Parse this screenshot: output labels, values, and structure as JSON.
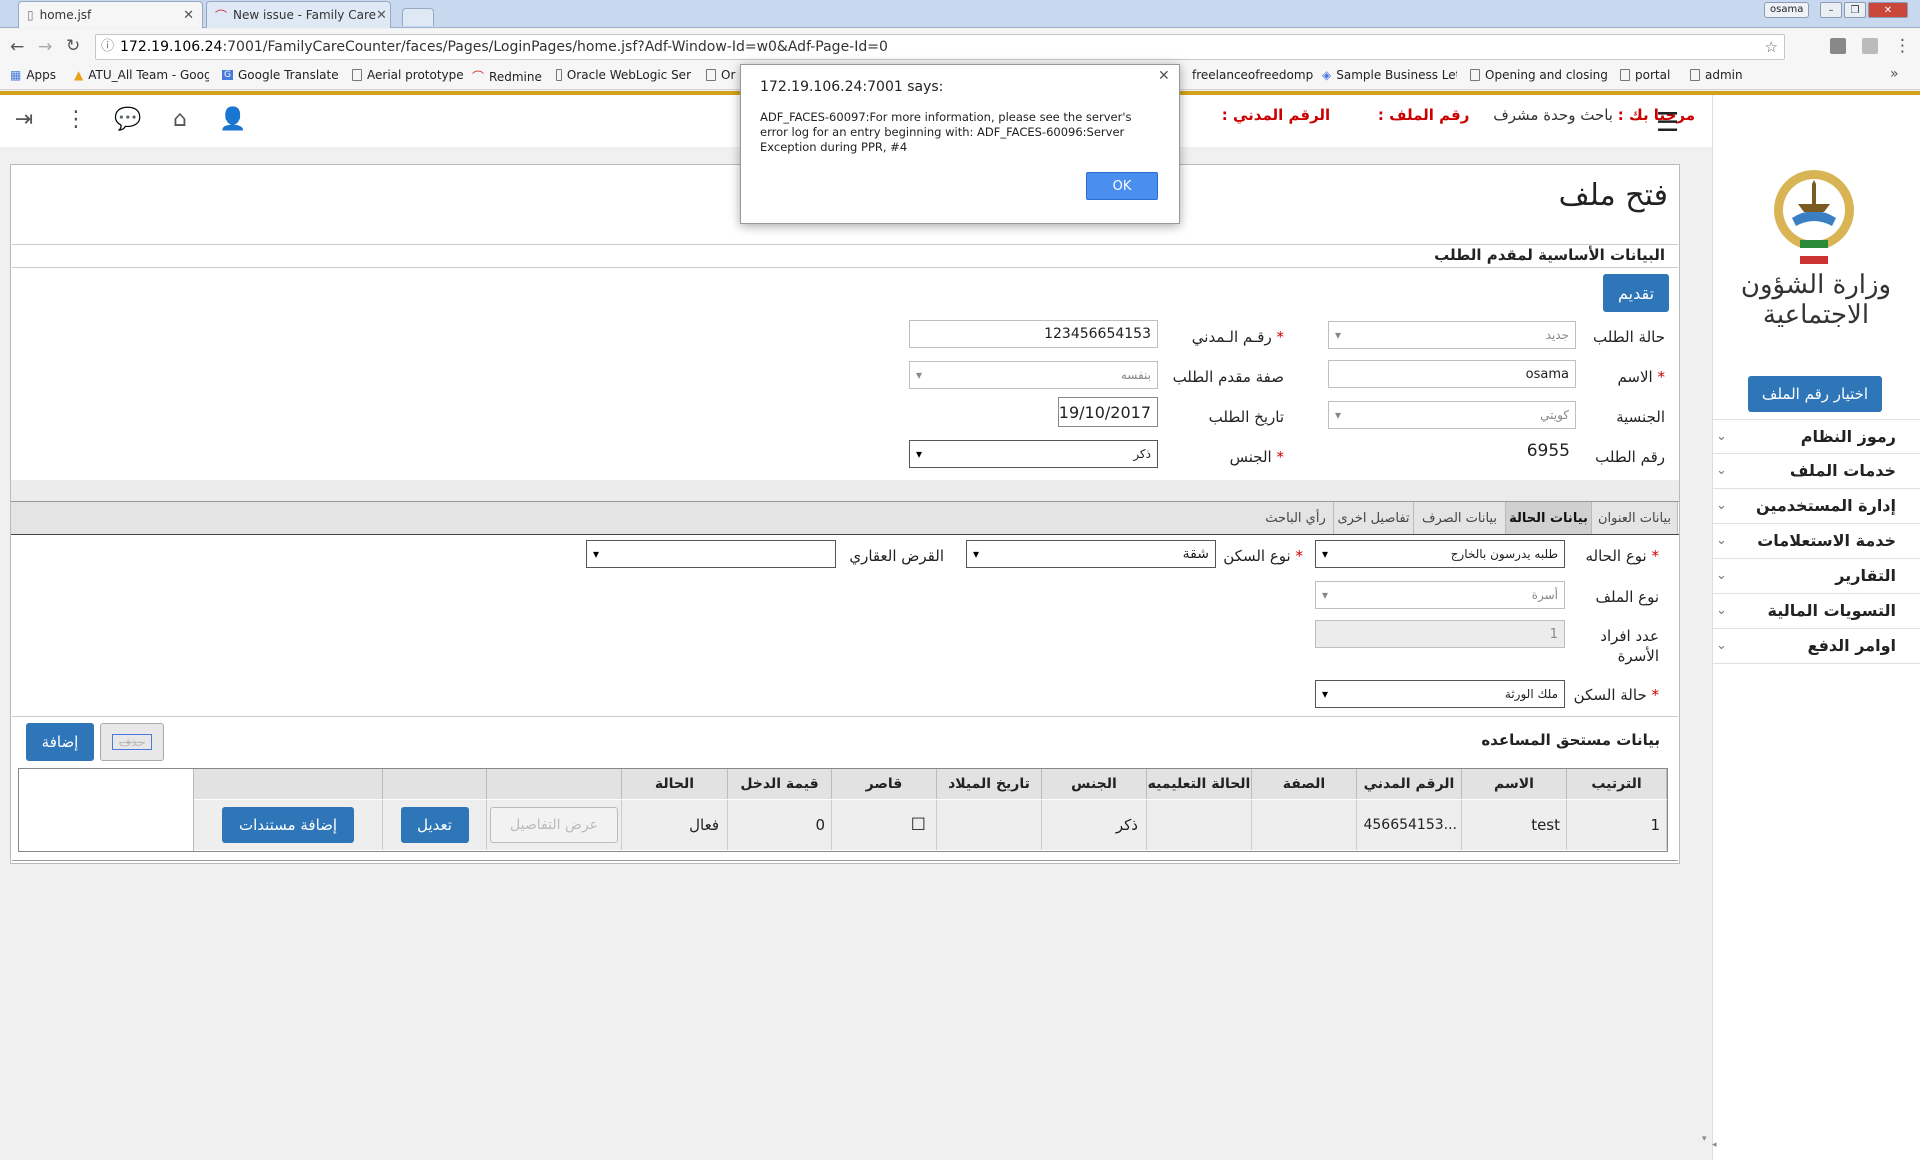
{
  "browser": {
    "tabs": [
      {
        "label": "home.jsf"
      },
      {
        "label": "New issue - Family Care"
      }
    ],
    "window_user": "osama",
    "url_host": "172.19.106.24",
    "url_rest": ":7001/FamilyCareCounter/faces/Pages/LoginPages/home.jsf?Adf-Window-Id=w0&Adf-Page-Id=0",
    "bookmarks": [
      "Apps",
      "ATU_All Team - Goog",
      "Google Translate",
      "Aerial prototype",
      "Redmine",
      "Oracle WebLogic Ser",
      "Or",
      "freelanceofreedomp",
      "Sample Business Lett",
      "Opening and closing",
      "portal",
      "admin"
    ]
  },
  "dialog": {
    "title": "172.19.106.24:7001 says:",
    "message": "ADF_FACES-60097:For more information, please see the server's error log for an entry beginning with: ADF_FACES-60096:Server Exception during PPR, #4",
    "ok": "OK"
  },
  "header": {
    "welcome_label": "مرحبا بك :",
    "welcome_name": "باحث وحدة مشرف",
    "file_no_label": "رقم الملف :",
    "civil_label": "الرقم المدني :"
  },
  "sidebar": {
    "ministry": "وزارة الشؤون الاجتماعية",
    "choose_file_button": "اختيار رقم الملف",
    "menu": [
      "رموز النظام",
      "خدمات الملف",
      "إدارة المستخدمين",
      "خدمة الاستعلامات",
      "التقارير",
      "التسويات المالية",
      "اوامر الدفع"
    ]
  },
  "page": {
    "title": "فتح ملف",
    "section_basic": "البيانات الأساسية لمقدم الطلب",
    "submit_button": "تقديم",
    "fields": {
      "request_status_label": "حالة الطلب",
      "request_status_value": "جديد",
      "civil_id_label": "رقـم الـمدني",
      "civil_id_value": "123456654153",
      "name_label": "الاسم",
      "name_value": "osama",
      "applicant_role_label": "صفة مقدم الطلب",
      "applicant_role_value": "بنفسه",
      "nationality_label": "الجنسية",
      "nationality_value": "كويتي",
      "request_date_label": "تاريخ الطلب",
      "request_date_value": "19/10/2017",
      "request_no_label": "رقم الطلب",
      "request_no_value": "6955",
      "gender_label": "الجنس",
      "gender_value": "ذكر"
    },
    "tabs": [
      "بيانات العنوان",
      "بيانات الحالة",
      "بيانات الصرف",
      "تفاصيل اخرى",
      "رأي الباحث"
    ],
    "case": {
      "case_type_label": "نوع الحاله",
      "case_type_value": "طلبه يدرسون بالخارج",
      "housing_type_label": "نوع السكن",
      "housing_type_value": "شقة",
      "loan_label": "القرض العقاري",
      "loan_value": "",
      "file_type_label": "نوع الملف",
      "file_type_value": "أسرة",
      "family_count_label": "عدد افراد الأسرة",
      "family_count_value": "1",
      "housing_status_label": "حالة السكن",
      "housing_status_value": "ملك الورثة"
    },
    "beneficiaries": {
      "title": "بيانات مستحق المساعده",
      "add_button": "إضافة",
      "delete_button": "حذف",
      "columns": [
        "الترتيب",
        "الاسم",
        "الرقم المدني",
        "الصفة",
        "الحالة التعليميه",
        "الجنس",
        "تاريخ الميلاد",
        "قاصر",
        "قيمة الدخل",
        "الحالة"
      ],
      "rows": [
        {
          "order": "1",
          "name": "test",
          "civil": "456654153...",
          "role": "",
          "education": "",
          "gender": "ذكر",
          "birth": "",
          "minor": "☐",
          "income": "0",
          "status": "فعال",
          "details_button": "عرض التفاصيل",
          "edit_button": "تعديل",
          "docs_button": "إضافة مستندات"
        }
      ]
    }
  }
}
